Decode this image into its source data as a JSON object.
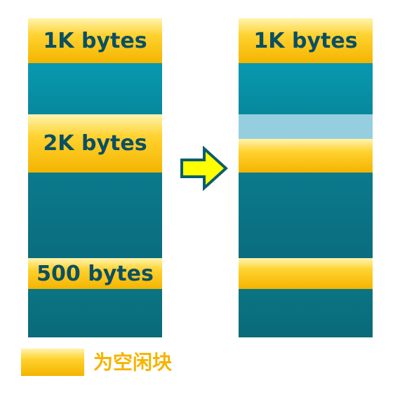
{
  "left_column": {
    "free_blocks": [
      {
        "label": "1K bytes"
      },
      {
        "label": "2K bytes"
      },
      {
        "label": "500 bytes"
      }
    ]
  },
  "right_column": {
    "free_blocks": [
      {
        "label": "1K bytes"
      }
    ]
  },
  "arrow": {
    "icon": "right-arrow-icon",
    "fill": "#ffff00",
    "stroke": "#0b5d6e"
  },
  "legend": {
    "label": "为空闲块",
    "color": "#f5b400"
  },
  "colors": {
    "free_block": "#ffd22f",
    "used_block": "#0a6d7f",
    "allocated_light": "#95cfdf",
    "label_text": "#0b4f63"
  }
}
